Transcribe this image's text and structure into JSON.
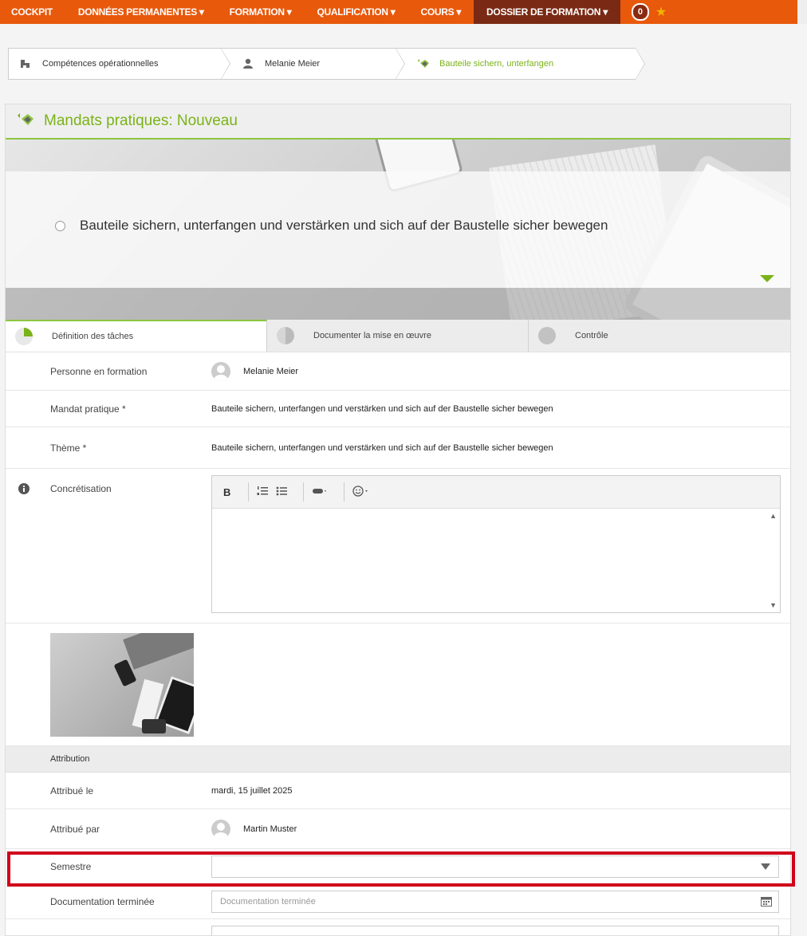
{
  "nav": {
    "items": [
      {
        "label": "COCKPIT",
        "active": false
      },
      {
        "label": "DONNÉES PERMANENTES ▾",
        "active": false
      },
      {
        "label": "FORMATION ▾",
        "active": false
      },
      {
        "label": "QUALIFICATION ▾",
        "active": false
      },
      {
        "label": "COURS ▾",
        "active": false
      },
      {
        "label": "DOSSIER DE FORMATION ▾",
        "active": true
      }
    ],
    "badge_count": "0",
    "star_icon": "star-icon",
    "accent_color": "#e8590c"
  },
  "breadcrumb": [
    {
      "icon": "competence-icon",
      "label": "Compétences opérationnelles"
    },
    {
      "icon": "user-icon",
      "label": "Melanie Meier"
    },
    {
      "icon": "hand-icon",
      "label": "Bauteile sichern, unterfangen"
    }
  ],
  "panel": {
    "title": "Mandats pratiques: Nouveau",
    "task": "Bauteile sichern, unterfangen und verstärken und sich auf der Baustelle sicher bewegen",
    "tabs": [
      {
        "label": "Définition des tâches",
        "active": true
      },
      {
        "label": "Documenter la mise en œuvre",
        "active": false
      },
      {
        "label": "Contrôle",
        "active": false
      }
    ]
  },
  "fields": {
    "trainee_label": "Personne en formation",
    "trainee_value": "Melanie Meier",
    "mandate_label": "Mandat pratique *",
    "mandate_value": "Bauteile sichern, unterfangen und verstärken und sich auf der Baustelle sicher bewegen",
    "theme_label": "Thème *",
    "theme_value": "Bauteile sichern, unterfangen und verstärken und sich auf der Baustelle sicher bewegen",
    "concretisation_label": "Concrétisation",
    "editor_bold": "B"
  },
  "attribution": {
    "section_label": "Attribution",
    "assigned_on_label": "Attribué le",
    "assigned_on_value": "mardi, 15 juillet 2025",
    "assigned_by_label": "Attribué par",
    "assigned_by_value": "Martin Muster",
    "semester_label": "Semestre",
    "semester_value": "",
    "doc_done_label": "Documentation terminée",
    "doc_done_placeholder": "Documentation terminée"
  },
  "colors": {
    "green": "#7ab317",
    "highlight": "#d0011b"
  }
}
